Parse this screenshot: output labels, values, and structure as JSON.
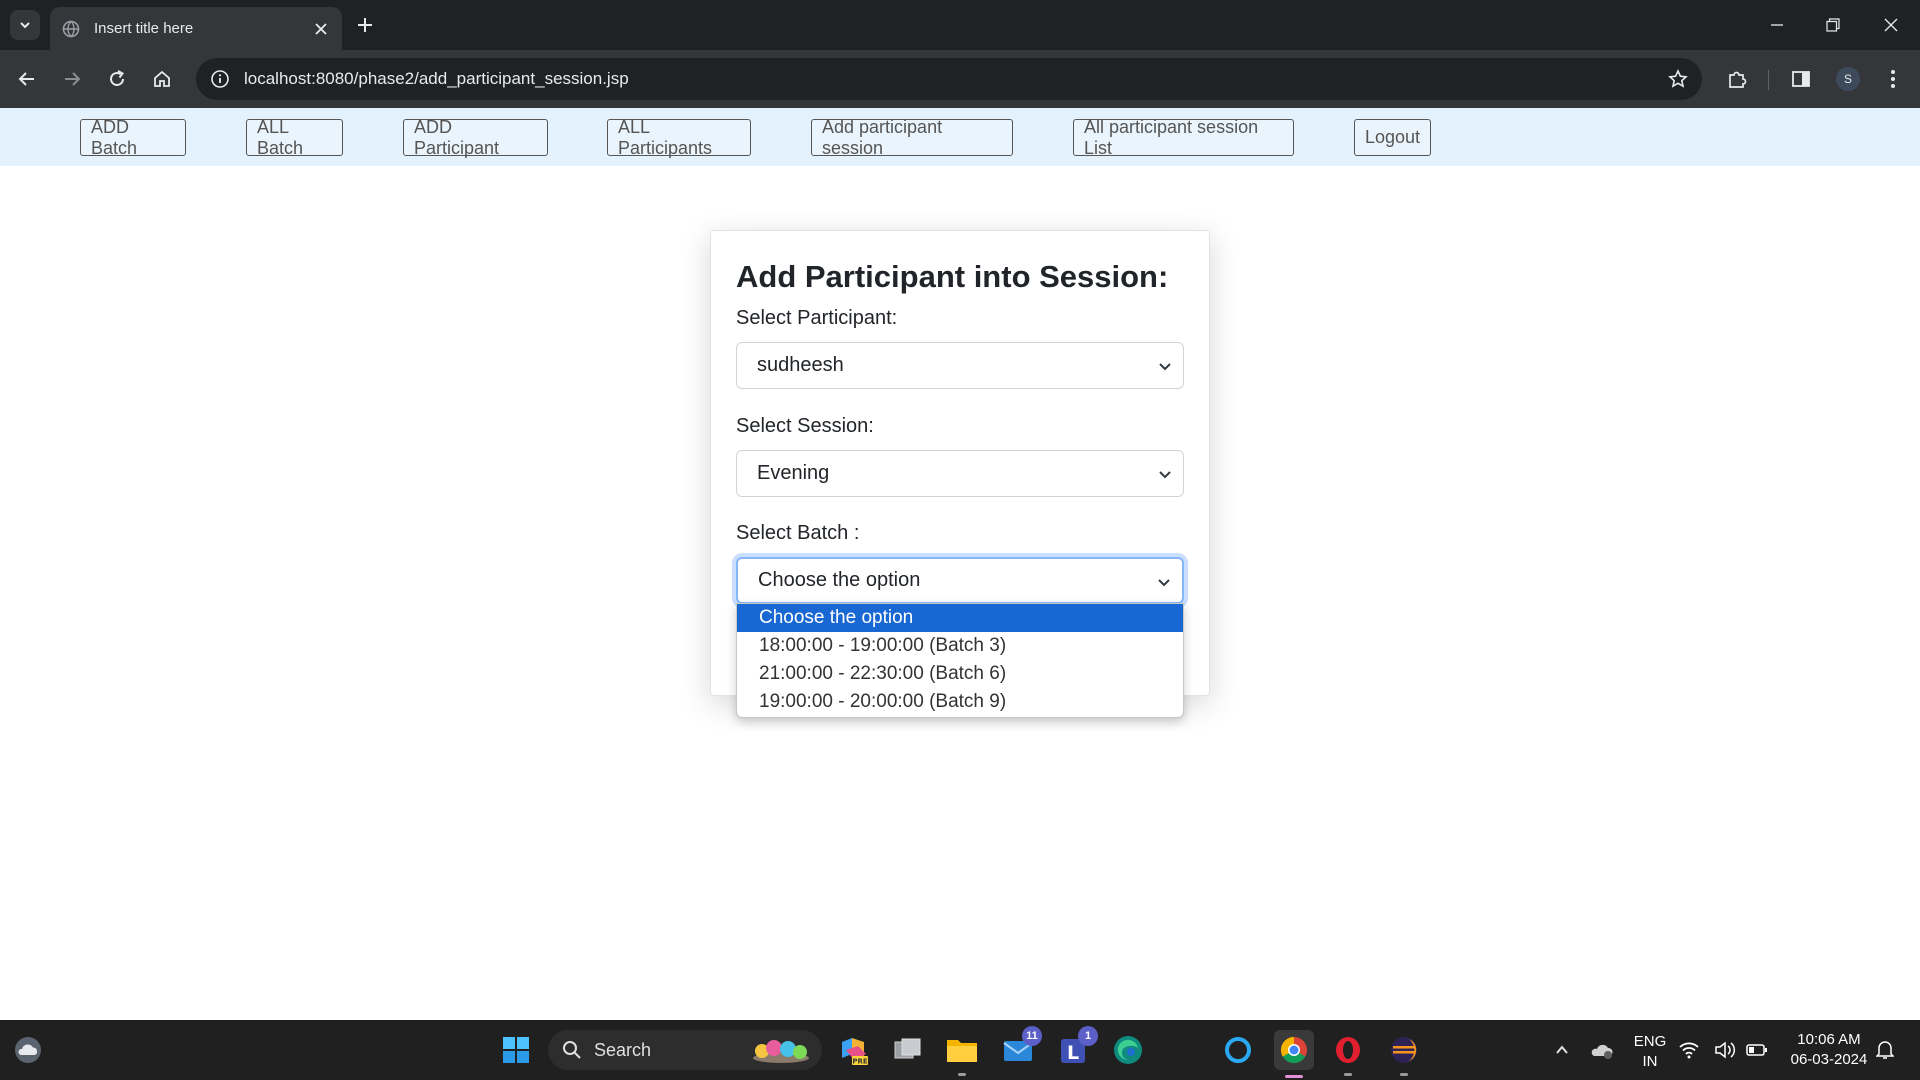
{
  "browser": {
    "tab_title": "Insert title here",
    "url": "localhost:8080/phase2/add_participant_session.jsp",
    "profile_initial": "S"
  },
  "nav": {
    "links": [
      "ADD Batch",
      "ALL Batch",
      "ADD Participant",
      "ALL Participants",
      "Add participant session",
      "All participant session List",
      "Logout"
    ]
  },
  "form": {
    "heading": "Add Participant into Session:",
    "participant_label": "Select Participant:",
    "participant_value": "sudheesh",
    "session_label": "Select Session:",
    "session_value": "Evening",
    "batch_label": "Select Batch :",
    "batch_value": "Choose the option",
    "batch_options": [
      "Choose the option",
      "18:00:00 - 19:00:00 (Batch 3)",
      "21:00:00 - 22:30:00 (Batch 6)",
      "19:00:00 - 20:00:00 (Batch 9)"
    ],
    "batch_selected_index": 0
  },
  "taskbar": {
    "search_label": "Search",
    "mail_badge": "11",
    "teams_badge": "1",
    "language_line1": "ENG",
    "language_line2": "IN",
    "time": "10:06 AM",
    "date": "06-03-2024"
  },
  "colors": {
    "navbar_bg": "#e3f2fd",
    "option_highlight": "#1967d2",
    "focus_ring": "#86b7fe"
  }
}
